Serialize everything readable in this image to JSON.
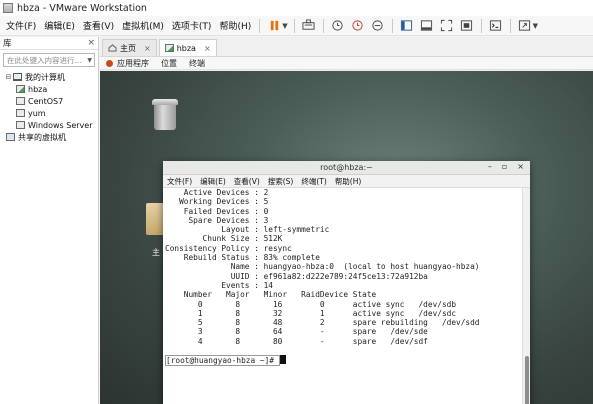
{
  "window": {
    "title": "hbza - VMware Workstation"
  },
  "menubar": {
    "items": [
      "文件(F)",
      "编辑(E)",
      "查看(V)",
      "虚拟机(M)",
      "选项卡(T)",
      "帮助(H)"
    ]
  },
  "library": {
    "header": "库",
    "close": "×",
    "search_placeholder": "在此处键入内容进行...",
    "tree": [
      {
        "label": "我的计算机",
        "expander": "⊟"
      },
      {
        "label": "hbza"
      },
      {
        "label": "CentOS7"
      },
      {
        "label": "yum"
      },
      {
        "label": "Windows Server"
      },
      {
        "label": "共享的虚拟机"
      }
    ]
  },
  "tabs": [
    {
      "label": "主页",
      "close": "×"
    },
    {
      "label": "hbza",
      "close": "×"
    }
  ],
  "guest_bar": {
    "items": [
      "应用程序",
      "位置",
      "终端"
    ]
  },
  "desktop": {
    "icon_caption_1": "主"
  },
  "terminal": {
    "title": "root@hbza:~",
    "controls": [
      "–",
      "▫",
      "×"
    ],
    "menu": [
      "文件(F)",
      "编辑(E)",
      "查看(V)",
      "搜索(S)",
      "终端(T)",
      "帮助(H)"
    ],
    "lines": [
      "    Active Devices : 2",
      "   Working Devices : 5",
      "    Failed Devices : 0",
      "     Spare Devices : 3",
      "",
      "            Layout : left-symmetric",
      "        Chunk Size : 512K",
      "",
      "Consistency Policy : resync",
      "",
      "    Rebuild Status : 83% complete",
      "",
      "              Name : huangyao-hbza:0  (local to host huangyao-hbza)",
      "              UUID : ef961a82:d222e789:24f5ce13:72a912ba",
      "            Events : 14",
      "",
      "    Number   Major   Minor   RaidDevice State",
      "       0       8       16        0      active sync   /dev/sdb",
      "       1       8       32        1      active sync   /dev/sdc",
      "       5       8       48        2      spare rebuilding   /dev/sdd",
      "",
      "       3       8       64        -      spare   /dev/sde",
      "       4       8       80        -      spare   /dev/sdf"
    ],
    "prompt": "[root@huangyao-hbza ~]# "
  }
}
